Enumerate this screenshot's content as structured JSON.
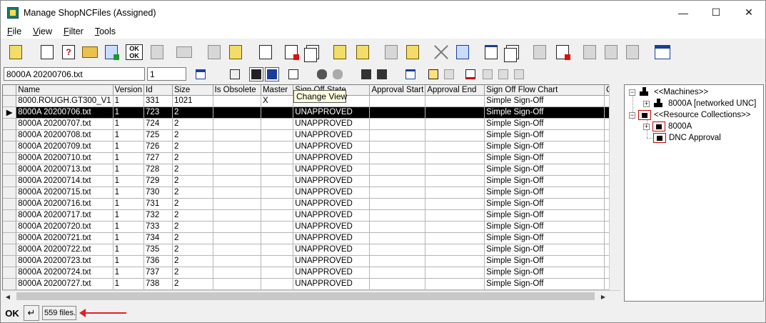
{
  "window": {
    "title": "Manage ShopNCFiles (Assigned)",
    "minimize_glyph": "—",
    "maximize_glyph": "☐",
    "close_glyph": "✕"
  },
  "menu": [
    {
      "label": "File",
      "u": "F",
      "rest": "ile"
    },
    {
      "label": "View",
      "u": "V",
      "rest": "iew"
    },
    {
      "label": "Filter",
      "u": "F",
      "rest": "ilter"
    },
    {
      "label": "Tools",
      "u": "T",
      "rest": "ools"
    }
  ],
  "toolbar2": {
    "filename_value": "8000A 20200706.txt",
    "version_value": "1"
  },
  "tooltip": "Change View",
  "grid": {
    "columns": [
      "",
      "Name",
      "Version",
      "Id",
      "Size",
      "Is Obsolete",
      "Master",
      "Sign Off State",
      "Approval Start",
      "Approval End",
      "Sign Off Flow Chart",
      "C"
    ],
    "rows": [
      {
        "name": "8000.ROUGH.GT300_V1",
        "version": "1",
        "id": "331",
        "size": "1021",
        "obsolete": "",
        "master": "X",
        "state": "U",
        "start": "",
        "end": "",
        "flow": "Simple Sign-Off"
      },
      {
        "name": "8000A 20200706.txt",
        "version": "1",
        "id": "723",
        "size": "2",
        "obsolete": "",
        "master": "",
        "state": "UNAPPROVED",
        "start": "",
        "end": "",
        "flow": "Simple Sign-Off"
      },
      {
        "name": "8000A 20200707.txt",
        "version": "1",
        "id": "724",
        "size": "2",
        "obsolete": "",
        "master": "",
        "state": "UNAPPROVED",
        "start": "",
        "end": "",
        "flow": "Simple Sign-Off"
      },
      {
        "name": "8000A 20200708.txt",
        "version": "1",
        "id": "725",
        "size": "2",
        "obsolete": "",
        "master": "",
        "state": "UNAPPROVED",
        "start": "",
        "end": "",
        "flow": "Simple Sign-Off"
      },
      {
        "name": "8000A 20200709.txt",
        "version": "1",
        "id": "726",
        "size": "2",
        "obsolete": "",
        "master": "",
        "state": "UNAPPROVED",
        "start": "",
        "end": "",
        "flow": "Simple Sign-Off"
      },
      {
        "name": "8000A 20200710.txt",
        "version": "1",
        "id": "727",
        "size": "2",
        "obsolete": "",
        "master": "",
        "state": "UNAPPROVED",
        "start": "",
        "end": "",
        "flow": "Simple Sign-Off"
      },
      {
        "name": "8000A 20200713.txt",
        "version": "1",
        "id": "728",
        "size": "2",
        "obsolete": "",
        "master": "",
        "state": "UNAPPROVED",
        "start": "",
        "end": "",
        "flow": "Simple Sign-Off"
      },
      {
        "name": "8000A 20200714.txt",
        "version": "1",
        "id": "729",
        "size": "2",
        "obsolete": "",
        "master": "",
        "state": "UNAPPROVED",
        "start": "",
        "end": "",
        "flow": "Simple Sign-Off"
      },
      {
        "name": "8000A 20200715.txt",
        "version": "1",
        "id": "730",
        "size": "2",
        "obsolete": "",
        "master": "",
        "state": "UNAPPROVED",
        "start": "",
        "end": "",
        "flow": "Simple Sign-Off"
      },
      {
        "name": "8000A 20200716.txt",
        "version": "1",
        "id": "731",
        "size": "2",
        "obsolete": "",
        "master": "",
        "state": "UNAPPROVED",
        "start": "",
        "end": "",
        "flow": "Simple Sign-Off"
      },
      {
        "name": "8000A 20200717.txt",
        "version": "1",
        "id": "732",
        "size": "2",
        "obsolete": "",
        "master": "",
        "state": "UNAPPROVED",
        "start": "",
        "end": "",
        "flow": "Simple Sign-Off"
      },
      {
        "name": "8000A 20200720.txt",
        "version": "1",
        "id": "733",
        "size": "2",
        "obsolete": "",
        "master": "",
        "state": "UNAPPROVED",
        "start": "",
        "end": "",
        "flow": "Simple Sign-Off"
      },
      {
        "name": "8000A 20200721.txt",
        "version": "1",
        "id": "734",
        "size": "2",
        "obsolete": "",
        "master": "",
        "state": "UNAPPROVED",
        "start": "",
        "end": "",
        "flow": "Simple Sign-Off"
      },
      {
        "name": "8000A 20200722.txt",
        "version": "1",
        "id": "735",
        "size": "2",
        "obsolete": "",
        "master": "",
        "state": "UNAPPROVED",
        "start": "",
        "end": "",
        "flow": "Simple Sign-Off"
      },
      {
        "name": "8000A 20200723.txt",
        "version": "1",
        "id": "736",
        "size": "2",
        "obsolete": "",
        "master": "",
        "state": "UNAPPROVED",
        "start": "",
        "end": "",
        "flow": "Simple Sign-Off"
      },
      {
        "name": "8000A 20200724.txt",
        "version": "1",
        "id": "737",
        "size": "2",
        "obsolete": "",
        "master": "",
        "state": "UNAPPROVED",
        "start": "",
        "end": "",
        "flow": "Simple Sign-Off"
      },
      {
        "name": "8000A 20200727.txt",
        "version": "1",
        "id": "738",
        "size": "2",
        "obsolete": "",
        "master": "",
        "state": "UNAPPROVED",
        "start": "",
        "end": "",
        "flow": "Simple Sign-Off"
      }
    ],
    "selected_row_indicator": "▶"
  },
  "tree": {
    "machines_label": "<<Machines>>",
    "machine_item": "8000A [networked UNC]",
    "collections_label": "<<Resource Collections>>",
    "collection_items": [
      "8000A",
      "DNC Approval"
    ]
  },
  "status": {
    "ok_label": "OK",
    "return_glyph": "↵",
    "file_count": "559 files."
  },
  "colors": {
    "selection_bg": "#000000",
    "annotation_arrow": "#e0202a",
    "tooltip_bg": "#ffffe1"
  }
}
